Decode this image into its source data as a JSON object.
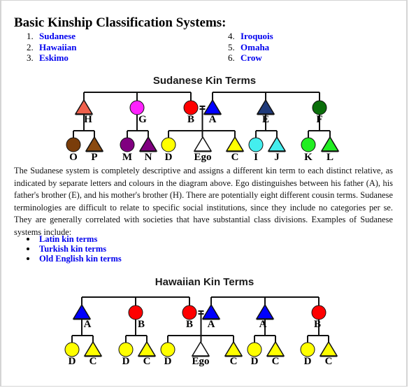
{
  "heading": "Basic Kinship Classification Systems:",
  "systems_left": [
    {
      "num": "1.",
      "label": "Sudanese"
    },
    {
      "num": "2.",
      "label": "Hawaiian"
    },
    {
      "num": "3.",
      "label": "Eskimo"
    }
  ],
  "systems_right": [
    {
      "num": "4.",
      "label": "Iroquois"
    },
    {
      "num": "5.",
      "label": "Omaha"
    },
    {
      "num": "6.",
      "label": "Crow"
    }
  ],
  "sudanese": {
    "title": "Sudanese Kin Terms",
    "parents": [
      {
        "label": "H",
        "shape": "triangle",
        "color": "#f0604c"
      },
      {
        "label": "G",
        "shape": "circle",
        "color": "#ff22ff"
      },
      {
        "label": "B",
        "shape": "circle",
        "color": "#ff0000"
      },
      {
        "label": "A",
        "shape": "triangle",
        "color": "#0000ff"
      },
      {
        "label": "E",
        "shape": "triangle",
        "color": "#1f3a7a"
      },
      {
        "label": "F",
        "shape": "circle",
        "color": "#0a6e0a"
      }
    ],
    "children": [
      {
        "label": "O",
        "shape": "circle",
        "color": "#7a3d0a"
      },
      {
        "label": "P",
        "shape": "triangle",
        "color": "#8a4a10"
      },
      {
        "label": "M",
        "shape": "circle",
        "color": "#800080"
      },
      {
        "label": "N",
        "shape": "triangle",
        "color": "#800080"
      },
      {
        "label": "D",
        "shape": "circle",
        "color": "#ffff00"
      },
      {
        "label": "Ego",
        "shape": "triangle",
        "color": "#ffffff"
      },
      {
        "label": "C",
        "shape": "triangle",
        "color": "#ffff00"
      },
      {
        "label": "I",
        "shape": "circle",
        "color": "#44eeee"
      },
      {
        "label": "J",
        "shape": "triangle",
        "color": "#44eeee"
      },
      {
        "label": "K",
        "shape": "circle",
        "color": "#22ee22"
      },
      {
        "label": "L",
        "shape": "triangle",
        "color": "#22ee22"
      }
    ]
  },
  "paragraph": "The Sudanese system is completely descriptive and assigns a different kin term to each distinct relative, as indicated by separate letters and colours in the diagram above. Ego distinguishes between his father (A), his father's brother (E), and his mother's brother (H). There are potentially eight different cousin terms. Sudanese terminologies are difficult to relate to specific social institutions, since they include no categories per se. They are generally correlated with societies that have substantial class divisions. Examples of Sudanese systems include:",
  "examples": [
    "Latin kin terms",
    "Turkish kin terms",
    "Old English kin terms"
  ],
  "hawaiian": {
    "title": "Hawaiian Kin Terms",
    "parents": [
      {
        "label": "A",
        "shape": "triangle",
        "color": "#0000ff"
      },
      {
        "label": "B",
        "shape": "circle",
        "color": "#ff0000"
      },
      {
        "label": "B",
        "shape": "circle",
        "color": "#ff0000"
      },
      {
        "label": "A",
        "shape": "triangle",
        "color": "#0000ff"
      },
      {
        "label": "A",
        "shape": "triangle",
        "color": "#0000ff"
      },
      {
        "label": "B",
        "shape": "circle",
        "color": "#ff0000"
      }
    ],
    "children": [
      {
        "label": "D",
        "shape": "circle",
        "color": "#ffff00"
      },
      {
        "label": "C",
        "shape": "triangle",
        "color": "#ffff00"
      },
      {
        "label": "D",
        "shape": "circle",
        "color": "#ffff00"
      },
      {
        "label": "C",
        "shape": "triangle",
        "color": "#ffff00"
      },
      {
        "label": "D",
        "shape": "circle",
        "color": "#ffff00"
      },
      {
        "label": "Ego",
        "shape": "triangle",
        "color": "#ffffff"
      },
      {
        "label": "C",
        "shape": "triangle",
        "color": "#ffff00"
      },
      {
        "label": "D",
        "shape": "circle",
        "color": "#ffff00"
      },
      {
        "label": "C",
        "shape": "triangle",
        "color": "#ffff00"
      },
      {
        "label": "D",
        "shape": "circle",
        "color": "#ffff00"
      },
      {
        "label": "C",
        "shape": "triangle",
        "color": "#ffff00"
      }
    ]
  }
}
